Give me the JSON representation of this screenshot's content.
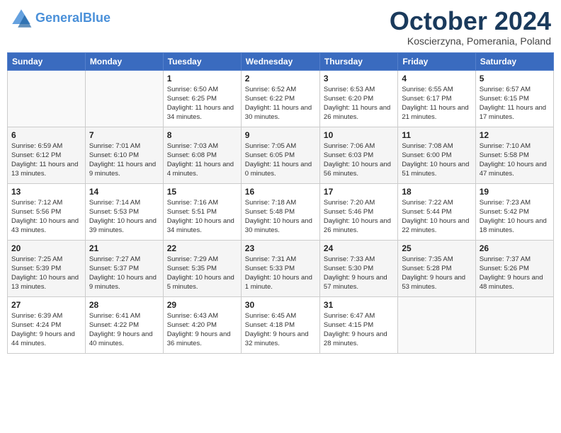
{
  "header": {
    "logo_line1": "General",
    "logo_line2": "Blue",
    "month": "October 2024",
    "location": "Koscierzyna, Pomerania, Poland"
  },
  "days_of_week": [
    "Sunday",
    "Monday",
    "Tuesday",
    "Wednesday",
    "Thursday",
    "Friday",
    "Saturday"
  ],
  "weeks": [
    [
      {
        "day": "",
        "sunrise": "",
        "sunset": "",
        "daylight": ""
      },
      {
        "day": "",
        "sunrise": "",
        "sunset": "",
        "daylight": ""
      },
      {
        "day": "1",
        "sunrise": "Sunrise: 6:50 AM",
        "sunset": "Sunset: 6:25 PM",
        "daylight": "Daylight: 11 hours and 34 minutes."
      },
      {
        "day": "2",
        "sunrise": "Sunrise: 6:52 AM",
        "sunset": "Sunset: 6:22 PM",
        "daylight": "Daylight: 11 hours and 30 minutes."
      },
      {
        "day": "3",
        "sunrise": "Sunrise: 6:53 AM",
        "sunset": "Sunset: 6:20 PM",
        "daylight": "Daylight: 11 hours and 26 minutes."
      },
      {
        "day": "4",
        "sunrise": "Sunrise: 6:55 AM",
        "sunset": "Sunset: 6:17 PM",
        "daylight": "Daylight: 11 hours and 21 minutes."
      },
      {
        "day": "5",
        "sunrise": "Sunrise: 6:57 AM",
        "sunset": "Sunset: 6:15 PM",
        "daylight": "Daylight: 11 hours and 17 minutes."
      }
    ],
    [
      {
        "day": "6",
        "sunrise": "Sunrise: 6:59 AM",
        "sunset": "Sunset: 6:12 PM",
        "daylight": "Daylight: 11 hours and 13 minutes."
      },
      {
        "day": "7",
        "sunrise": "Sunrise: 7:01 AM",
        "sunset": "Sunset: 6:10 PM",
        "daylight": "Daylight: 11 hours and 9 minutes."
      },
      {
        "day": "8",
        "sunrise": "Sunrise: 7:03 AM",
        "sunset": "Sunset: 6:08 PM",
        "daylight": "Daylight: 11 hours and 4 minutes."
      },
      {
        "day": "9",
        "sunrise": "Sunrise: 7:05 AM",
        "sunset": "Sunset: 6:05 PM",
        "daylight": "Daylight: 11 hours and 0 minutes."
      },
      {
        "day": "10",
        "sunrise": "Sunrise: 7:06 AM",
        "sunset": "Sunset: 6:03 PM",
        "daylight": "Daylight: 10 hours and 56 minutes."
      },
      {
        "day": "11",
        "sunrise": "Sunrise: 7:08 AM",
        "sunset": "Sunset: 6:00 PM",
        "daylight": "Daylight: 10 hours and 51 minutes."
      },
      {
        "day": "12",
        "sunrise": "Sunrise: 7:10 AM",
        "sunset": "Sunset: 5:58 PM",
        "daylight": "Daylight: 10 hours and 47 minutes."
      }
    ],
    [
      {
        "day": "13",
        "sunrise": "Sunrise: 7:12 AM",
        "sunset": "Sunset: 5:56 PM",
        "daylight": "Daylight: 10 hours and 43 minutes."
      },
      {
        "day": "14",
        "sunrise": "Sunrise: 7:14 AM",
        "sunset": "Sunset: 5:53 PM",
        "daylight": "Daylight: 10 hours and 39 minutes."
      },
      {
        "day": "15",
        "sunrise": "Sunrise: 7:16 AM",
        "sunset": "Sunset: 5:51 PM",
        "daylight": "Daylight: 10 hours and 34 minutes."
      },
      {
        "day": "16",
        "sunrise": "Sunrise: 7:18 AM",
        "sunset": "Sunset: 5:48 PM",
        "daylight": "Daylight: 10 hours and 30 minutes."
      },
      {
        "day": "17",
        "sunrise": "Sunrise: 7:20 AM",
        "sunset": "Sunset: 5:46 PM",
        "daylight": "Daylight: 10 hours and 26 minutes."
      },
      {
        "day": "18",
        "sunrise": "Sunrise: 7:22 AM",
        "sunset": "Sunset: 5:44 PM",
        "daylight": "Daylight: 10 hours and 22 minutes."
      },
      {
        "day": "19",
        "sunrise": "Sunrise: 7:23 AM",
        "sunset": "Sunset: 5:42 PM",
        "daylight": "Daylight: 10 hours and 18 minutes."
      }
    ],
    [
      {
        "day": "20",
        "sunrise": "Sunrise: 7:25 AM",
        "sunset": "Sunset: 5:39 PM",
        "daylight": "Daylight: 10 hours and 13 minutes."
      },
      {
        "day": "21",
        "sunrise": "Sunrise: 7:27 AM",
        "sunset": "Sunset: 5:37 PM",
        "daylight": "Daylight: 10 hours and 9 minutes."
      },
      {
        "day": "22",
        "sunrise": "Sunrise: 7:29 AM",
        "sunset": "Sunset: 5:35 PM",
        "daylight": "Daylight: 10 hours and 5 minutes."
      },
      {
        "day": "23",
        "sunrise": "Sunrise: 7:31 AM",
        "sunset": "Sunset: 5:33 PM",
        "daylight": "Daylight: 10 hours and 1 minute."
      },
      {
        "day": "24",
        "sunrise": "Sunrise: 7:33 AM",
        "sunset": "Sunset: 5:30 PM",
        "daylight": "Daylight: 9 hours and 57 minutes."
      },
      {
        "day": "25",
        "sunrise": "Sunrise: 7:35 AM",
        "sunset": "Sunset: 5:28 PM",
        "daylight": "Daylight: 9 hours and 53 minutes."
      },
      {
        "day": "26",
        "sunrise": "Sunrise: 7:37 AM",
        "sunset": "Sunset: 5:26 PM",
        "daylight": "Daylight: 9 hours and 48 minutes."
      }
    ],
    [
      {
        "day": "27",
        "sunrise": "Sunrise: 6:39 AM",
        "sunset": "Sunset: 4:24 PM",
        "daylight": "Daylight: 9 hours and 44 minutes."
      },
      {
        "day": "28",
        "sunrise": "Sunrise: 6:41 AM",
        "sunset": "Sunset: 4:22 PM",
        "daylight": "Daylight: 9 hours and 40 minutes."
      },
      {
        "day": "29",
        "sunrise": "Sunrise: 6:43 AM",
        "sunset": "Sunset: 4:20 PM",
        "daylight": "Daylight: 9 hours and 36 minutes."
      },
      {
        "day": "30",
        "sunrise": "Sunrise: 6:45 AM",
        "sunset": "Sunset: 4:18 PM",
        "daylight": "Daylight: 9 hours and 32 minutes."
      },
      {
        "day": "31",
        "sunrise": "Sunrise: 6:47 AM",
        "sunset": "Sunset: 4:15 PM",
        "daylight": "Daylight: 9 hours and 28 minutes."
      },
      {
        "day": "",
        "sunrise": "",
        "sunset": "",
        "daylight": ""
      },
      {
        "day": "",
        "sunrise": "",
        "sunset": "",
        "daylight": ""
      }
    ]
  ]
}
